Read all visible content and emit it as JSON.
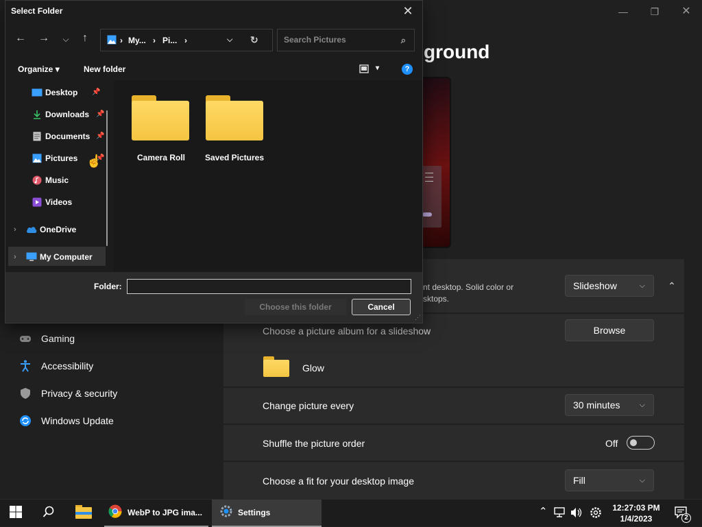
{
  "settings": {
    "heading": "ground",
    "personalize_desc_line1": "nt desktop. Solid color or",
    "personalize_desc_line2": "sktops.",
    "background_type": "Slideshow",
    "album_label": "Choose a picture album for a slideshow",
    "browse_label": "Browse",
    "album_name": "Glow",
    "change_every_label": "Change picture every",
    "change_every_value": "30 minutes",
    "shuffle_label": "Shuffle the picture order",
    "shuffle_state": "Off",
    "fit_label": "Choose a fit for your desktop image",
    "fit_value": "Fill"
  },
  "left_nav": {
    "items": [
      "Gaming",
      "Accessibility",
      "Privacy & security",
      "Windows Update"
    ]
  },
  "dialog": {
    "title": "Select Folder",
    "breadcrumb": [
      "My...",
      "Pi..."
    ],
    "search_placeholder": "Search Pictures",
    "organize_label": "Organize",
    "new_folder_label": "New folder",
    "tree": {
      "quick_access": [
        "Desktop",
        "Downloads",
        "Documents",
        "Pictures",
        "Music",
        "Videos"
      ],
      "onedrive": "OneDrive",
      "computer": "My Computer"
    },
    "folders": [
      "Camera Roll",
      "Saved Pictures"
    ],
    "folder_label": "Folder:",
    "folder_value": "",
    "choose_label": "Choose this folder",
    "cancel_label": "Cancel"
  },
  "taskbar": {
    "chrome_label": "WebP to JPG ima...",
    "settings_label": "Settings",
    "time": "12:27:03 PM",
    "date": "1/4/2023",
    "notification_count": "2"
  },
  "colors": {
    "accent": "#1e90ff",
    "folder": "#f4c542",
    "window_bg": "#202020",
    "card_bg": "#2b2b2b"
  }
}
